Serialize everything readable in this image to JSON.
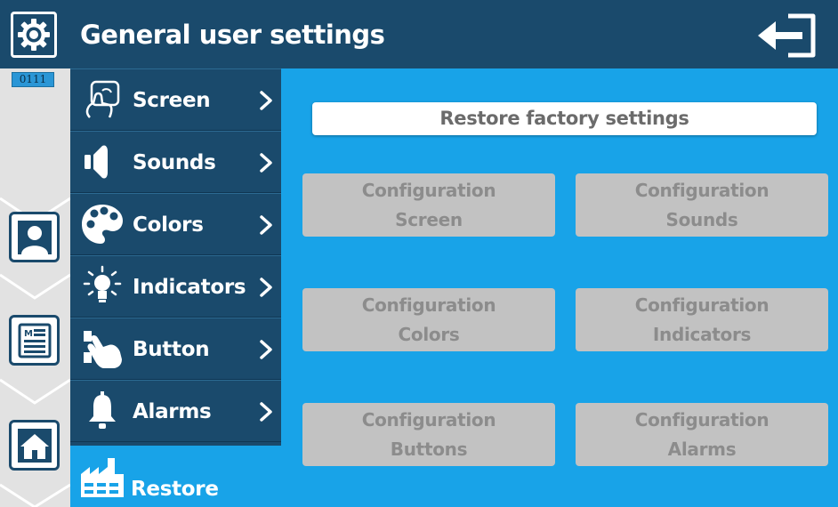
{
  "header": {
    "title": "General user settings",
    "app_icon": "gear-icon",
    "exit_icon": "logout-icon"
  },
  "rail": {
    "code": "0111",
    "tabs": [
      {
        "name": "user",
        "icon": "user-icon"
      },
      {
        "name": "document",
        "icon": "document-icon"
      },
      {
        "name": "home",
        "icon": "home-icon"
      }
    ]
  },
  "menu": {
    "items": [
      {
        "label": "Screen",
        "icon": "touch-screen-icon"
      },
      {
        "label": "Sounds",
        "icon": "speaker-icon"
      },
      {
        "label": "Colors",
        "icon": "palette-icon"
      },
      {
        "label": "Indicators",
        "icon": "lightbulb-icon"
      },
      {
        "label": "Button",
        "icon": "hand-press-icon"
      },
      {
        "label": "Alarms",
        "icon": "bell-icon"
      }
    ],
    "restore": {
      "label": "Restore",
      "icon": "factory-icon"
    }
  },
  "main": {
    "restore_button": "Restore factory settings",
    "buttons": [
      {
        "line1": "Configuration",
        "line2": "Screen"
      },
      {
        "line1": "Configuration",
        "line2": "Sounds"
      },
      {
        "line1": "Configuration",
        "line2": "Colors"
      },
      {
        "line1": "Configuration",
        "line2": "Indicators"
      },
      {
        "line1": "Configuration",
        "line2": "Buttons"
      },
      {
        "line1": "Configuration",
        "line2": "Alarms"
      }
    ]
  },
  "colors": {
    "header_bg": "#1a4a6c",
    "menu_bg": "#1a4a6c",
    "accent": "#18a3e8",
    "disabled_button": "#c2c2c2",
    "rail_bg": "#e2e2e2"
  }
}
